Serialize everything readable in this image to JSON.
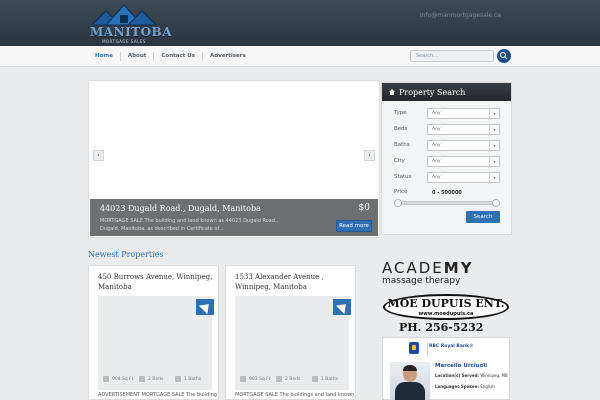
{
  "header": {
    "logo_text": "MANITOBA",
    "logo_sub": "MORTGAGE SALES",
    "email": "info@manmortgagesale.ca"
  },
  "nav": {
    "items": [
      {
        "label": "Home"
      },
      {
        "label": "About"
      },
      {
        "label": "Contact Us"
      },
      {
        "label": "Advertisers"
      }
    ],
    "search_placeholder": "Search...."
  },
  "slider": {
    "title": "44023 Dugald Road., Dugald, Manitoba",
    "price": "$0",
    "desc_line1": "MORTGAGE SALE The building and land known as 44023 Dugald Road.,",
    "desc_line2": "Dugald, Manitoba, as described in Certificate of...",
    "read_more": "Read more",
    "prev": "‹",
    "next": "›"
  },
  "property_search": {
    "title": "Property Search",
    "fields": [
      {
        "label": "Type",
        "value": "Any"
      },
      {
        "label": "Beds",
        "value": "Any"
      },
      {
        "label": "Baths",
        "value": "Any"
      },
      {
        "label": "City",
        "value": "Any"
      },
      {
        "label": "Status",
        "value": "Any"
      }
    ],
    "price_label": "Price",
    "price_range": "0 - 500000",
    "button": "Search"
  },
  "newest": {
    "title": "Newest Properties",
    "cards": [
      {
        "title": "450 Burrows Avenue, Winnipeg, Manitoba",
        "sqft": "904 Sq Ft",
        "beds": "2 Beds",
        "baths": "1 Baths",
        "desc": "ADVERTISEMENT MORTGAGE SALE The building"
      },
      {
        "title": "1533 Alexander Avenue , Winnipeg, Manitoba",
        "sqft": "963 Sq Ft",
        "beds": "2 Beds",
        "baths": "1 Baths",
        "desc": "MORTGAGE SALE The buildings and land known"
      }
    ]
  },
  "ads": {
    "academy_big_1": "ACADE",
    "academy_big_2": "MY",
    "academy_small": "massage therapy",
    "moe_name": "MOE DUPUIS ENT.",
    "moe_url": "www.moedupuis.ca",
    "moe_phone": "PH. 256-5232",
    "rbc_bank": "RBC Royal Bank®",
    "rbc_name": "Marcello Urciuoli",
    "rbc_loc_label": "Location(s) Served:",
    "rbc_loc_value": "Winnipeg, MB",
    "rbc_lang_label": "Languages Spoken:",
    "rbc_lang_value": "English"
  },
  "colors": {
    "brand_blue": "#2f6fb3",
    "header_dark": "#2b3540"
  }
}
